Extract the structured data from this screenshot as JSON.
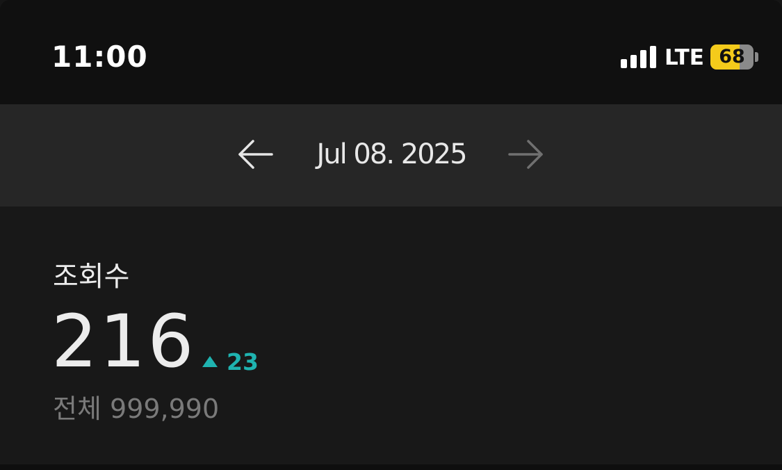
{
  "status_bar": {
    "time": "11:00",
    "network": "LTE",
    "signal_bars": 4,
    "signal_icon": "signal-bars-icon",
    "battery_level": "68",
    "battery_fraction": 0.68,
    "battery_color": "#f4cb1b"
  },
  "date_nav": {
    "prev_icon": "arrow-left-icon",
    "date": "Jul 08. 2025",
    "next_icon": "arrow-right-icon",
    "next_disabled": true
  },
  "stats": {
    "label": "조회수",
    "value": "216",
    "delta_icon": "triangle-up-icon",
    "delta": "23",
    "delta_color": "#1fb3b0",
    "total_label": "전체",
    "total_value": "999,990"
  }
}
